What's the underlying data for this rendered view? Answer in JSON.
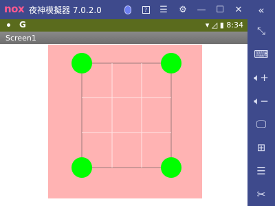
{
  "window": {
    "brand": "nox",
    "title": "夜神模擬器 7.0.2.0",
    "icons": [
      "mic-badge-icon",
      "help-icon",
      "menu-icon",
      "gear-icon",
      "minimize-icon",
      "maximize-icon",
      "close-icon"
    ],
    "collapse_icon": "collapse-icon"
  },
  "statusbar": {
    "left_icon": "notification-dot-icon",
    "g_label": "G",
    "time": "8:34"
  },
  "app": {
    "title": "Screen1"
  },
  "sidebar": {
    "tools": [
      "fullscreen-icon",
      "keyboard-icon",
      "volume-up-icon",
      "volume-down-icon",
      "screen-icon",
      "apk-install-icon",
      "multi-instance-icon",
      "scissors-icon"
    ]
  },
  "colors": {
    "window_bar": "#3e4a8c",
    "status_bar": "#5a6b1d",
    "app_bar": "#7a7a7a",
    "canvas_pink": "#ffb3b3",
    "ball_green": "#00ff00"
  }
}
